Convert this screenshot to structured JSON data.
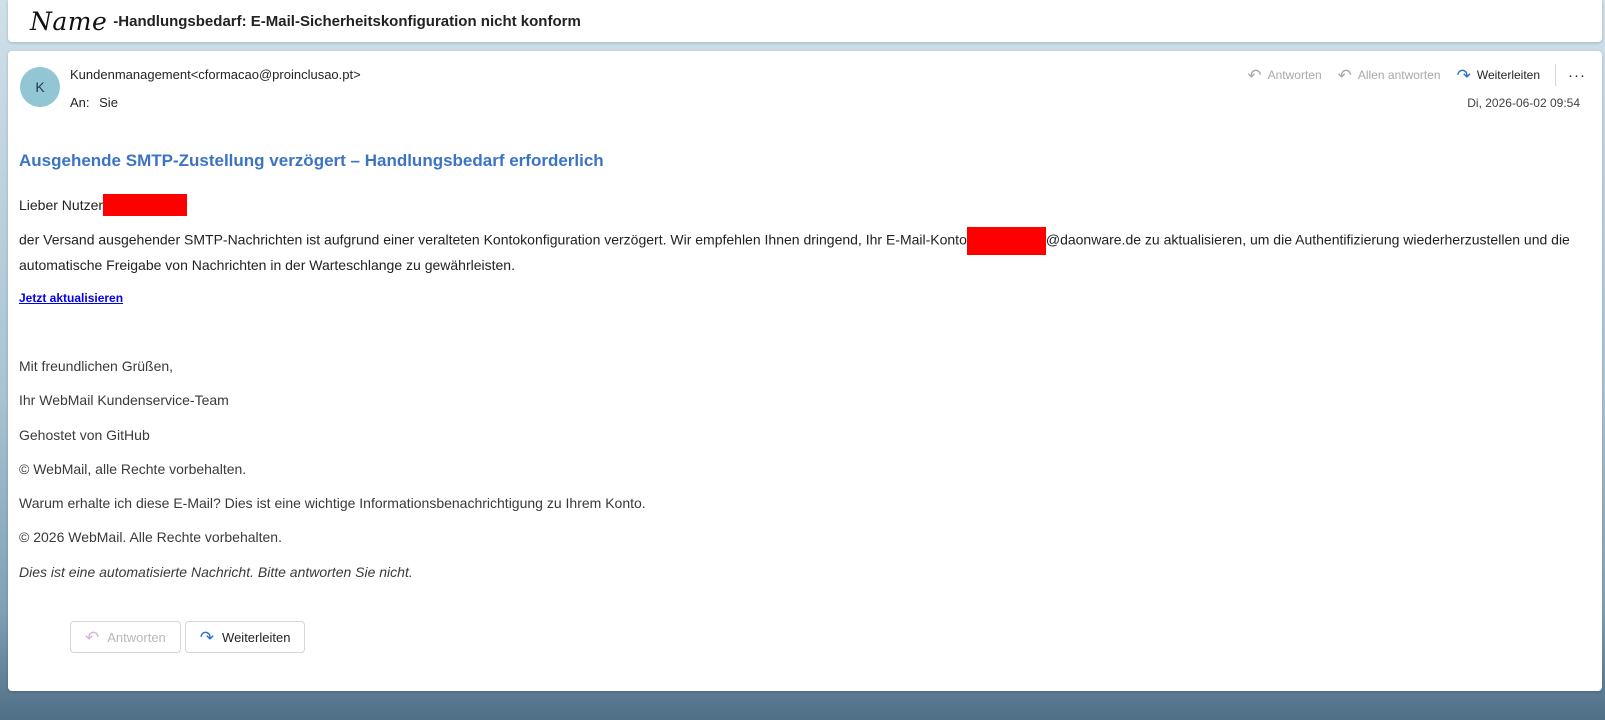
{
  "subject": {
    "name_tag": "Name",
    "title": "-Handlungsbedarf: E-Mail-Sicherheitskonfiguration nicht konform"
  },
  "header": {
    "avatar_initial": "K",
    "sender": "Kundenmanagement<cformacao@proinclusao.pt>",
    "to_label": "An:",
    "to_value": "Sie",
    "date": "Di, 2026-06-02 09:54"
  },
  "actions": {
    "reply": "Antworten",
    "reply_all": "Allen antworten",
    "forward": "Weiterleiten",
    "more": "···"
  },
  "body": {
    "heading": "Ausgehende SMTP-Zustellung verzögert – Handlungsbedarf erforderlich",
    "greeting": "Lieber Nutzer",
    "paragraph_part1": "der Versand ausgehender SMTP-Nachrichten ist aufgrund einer veralteten Kontokonfiguration verzögert. Wir empfehlen Ihnen dringend, Ihr E-Mail-Konto",
    "paragraph_part2": "@daonware.de zu aktualisieren, um die Authentifizierung wiederherzustellen und die automatische Freigabe von Nachrichten in der Warteschlange zu gewährleisten.",
    "link": "Jetzt aktualisieren",
    "signature": [
      "Mit freundlichen Grüßen,",
      "Ihr WebMail Kundenservice-Team",
      "Gehostet von GitHub",
      "© WebMail, alle Rechte vorbehalten.",
      "Warum erhalte ich diese E-Mail? Dies ist eine wichtige Informationsbenachrichtigung zu Ihrem Konto.",
      "© 2026 WebMail. Alle Rechte vorbehalten.",
      "Dies ist eine automatisierte Nachricht. Bitte antworten Sie nicht."
    ]
  },
  "bottom_buttons": {
    "reply": "Antworten",
    "forward": "Weiterleiten"
  },
  "colors": {
    "heading": "#3b73c6",
    "link": "#0000ee",
    "redaction": "#ff0000",
    "avatar": "#92c6d4",
    "forward_icon": "#2a6fc9"
  },
  "icons": {
    "reply": "reply-arrow-icon",
    "reply_all": "reply-all-arrow-icon",
    "forward": "forward-arrow-icon",
    "more": "more-horizontal-icon"
  }
}
